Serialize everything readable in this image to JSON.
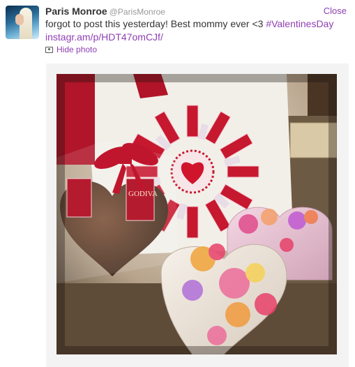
{
  "tweet": {
    "author_name": "Paris Monroe",
    "author_handle": "@ParisMonroe",
    "close_label": "Close",
    "text": "forgot to post this yesterday! Best mommy ever <3 ",
    "hashtag": "#ValentinesDay",
    "link": "instagr.am/p/HDT47omCJf/",
    "hide_photo_label": "Hide photo"
  },
  "icons": {
    "photo": "photo-icon",
    "avatar": "avatar"
  },
  "colors": {
    "link": "#8f3fb3",
    "text": "#333333",
    "muted": "#999999"
  },
  "photo_logo_text": {
    "godiva": "GODIVA"
  }
}
